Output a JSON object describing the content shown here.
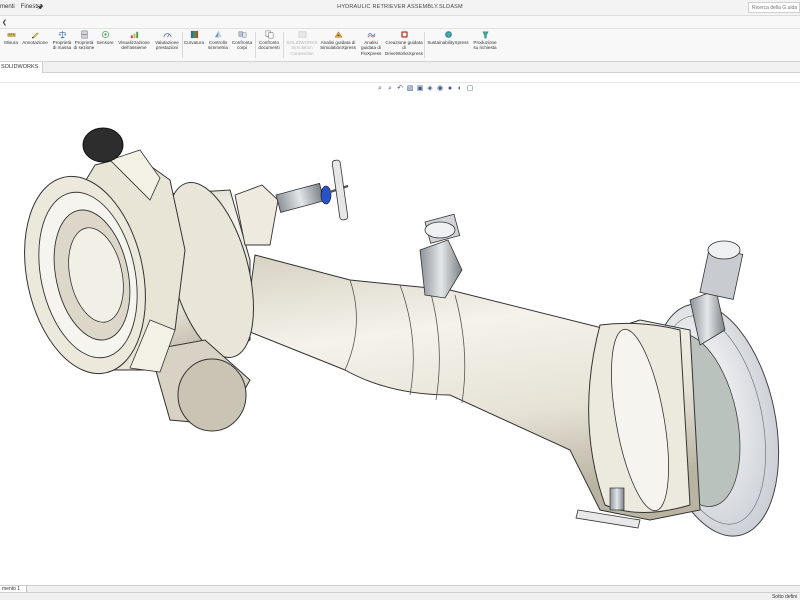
{
  "titlebar": {
    "menu": [
      "menti",
      "Finestra"
    ],
    "pin_icon": "pin-icon",
    "title": "HYDRAULIC RETRIEVER ASSEMBLY.SLDASM",
    "help_search_placeholder": "Ricerca della G.uida"
  },
  "ribbon": {
    "buttons": [
      {
        "label": "Misura",
        "icon": "measure-icon"
      },
      {
        "label": "Annotazione",
        "icon": "annotation-icon"
      },
      {
        "label": "Proprietà di massa",
        "icon": "mass-properties-icon"
      },
      {
        "label": "Proprietà di sezione",
        "icon": "section-properties-icon"
      },
      {
        "label": "Sensore",
        "icon": "sensor-icon"
      },
      {
        "label": "Visualizzazione dell'assieme",
        "icon": "assembly-visualization-icon"
      },
      {
        "label": "Valutazione prestazioni",
        "icon": "performance-evaluation-icon"
      },
      {
        "label": "Curvatura",
        "icon": "curvature-icon"
      },
      {
        "label": "Controllo simmetria",
        "icon": "symmetry-check-icon"
      },
      {
        "label": "Confronta corpi",
        "icon": "compare-bodies-icon"
      },
      {
        "label": "Confronto documenti",
        "icon": "compare-documents-icon"
      },
      {
        "label": "SOLIDWORKS Simulation Connection",
        "icon": "simulation-connection-icon"
      },
      {
        "label": "Analisi guidata di SimulationXpress",
        "icon": "simulationxpress-icon"
      },
      {
        "label": "Analisi guidata di FloXpress",
        "icon": "floxpress-icon"
      },
      {
        "label": "Creazione guidata di DriveWorksXpress",
        "icon": "driveworksxpress-icon"
      },
      {
        "label": "SustainabilityXpress",
        "icon": "sustainabilityxpress-icon"
      },
      {
        "label": "Produzione su richiesta",
        "icon": "manufacturing-on-demand-icon"
      }
    ]
  },
  "feature_tab": "SOLIDWORKS",
  "model": {
    "description": "hydraulic retriever assembly 3D model",
    "body_color": "#efece3",
    "shadow_color": "#c8c3b3",
    "metal_color": "#b8bcc0",
    "accent_blue": "#2a52c8"
  },
  "bottom_tab": "mento 1",
  "status": {
    "right_text": "Sotto defini"
  },
  "colors": {
    "ribbon_bg": "#f8f8f8",
    "viewport_bg": "#ffffff",
    "icon_blue": "#3a6aa8",
    "icon_red": "#c8342c",
    "icon_green": "#3f9a4a"
  }
}
